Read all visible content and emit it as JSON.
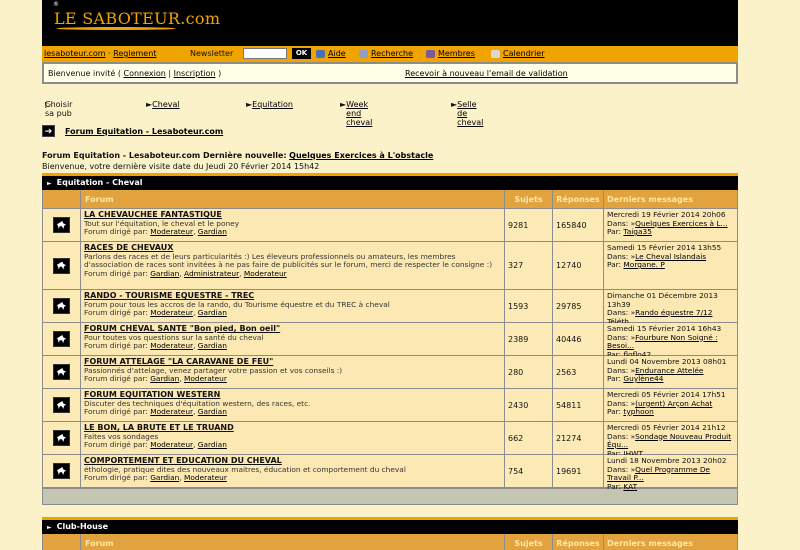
{
  "site": {
    "logo_text": "LE SABOTEUR.com",
    "logo_mark": "®"
  },
  "nav": {
    "home": "lesaboteur.com",
    "sep": " · ",
    "rules": "Reglement",
    "newsletter_label": "Newsletter",
    "newsletter_value": "",
    "ok_label": "OK",
    "items": [
      {
        "label": "Aide",
        "icon": "help-icon"
      },
      {
        "label": "Recherche",
        "icon": "search-icon"
      },
      {
        "label": "Membres",
        "icon": "members-icon"
      },
      {
        "label": "Calendrier",
        "icon": "calendar-icon"
      }
    ]
  },
  "welcome": {
    "prefix": "Bienvenue invité (",
    "login": "Connexion",
    "sep": "|",
    "signup": "Inscription",
    "suffix": ")",
    "email_link": "Recevoir à nouveau l'email de validation"
  },
  "promo": {
    "label": "Choisir sa pub",
    "links": [
      "Cheval",
      "Equitation",
      "Week end cheval",
      "Selle de cheval"
    ]
  },
  "breadcrumb": {
    "label": "Forum Equitation - Lesaboteur.com"
  },
  "info": {
    "title": "Forum Equitation - Lesaboteur.com Dernière nouvelle:",
    "news_link": "Quelques Exercices à L'obstacle",
    "last_visit": "Bienvenue, votre dernière visite date du Jeudi 20 Février 2014 15h42"
  },
  "columns": {
    "forum": "Forum",
    "topics": "Sujets",
    "replies": "Réponses",
    "last": "Derniers messages"
  },
  "categories": [
    {
      "name": "Equitation - Cheval",
      "forums": [
        {
          "title": "LA CHEVAUCHEE FANTASTIQUE",
          "desc": "Tout sur l'équitation, le cheval et le poney",
          "mod_prefix": "Forum dirigé par:",
          "mods": [
            "Moderateur",
            "Gardian"
          ],
          "topics": "9281",
          "replies": "165840",
          "last_date": "Mercredi 19 Février 2014 20h06",
          "last_in_prefix": "Dans: »",
          "last_in": "Quelques Exercices à L...",
          "last_by_prefix": "Par:",
          "last_by": "Taiga35"
        },
        {
          "title": "RACES DE CHEVAUX",
          "desc": "Parlons des races et de leurs particularités :) Les éleveurs professionnels ou amateurs, les membres d'association de races sont invitées à  ne pas faire de publicités sur le forum, merci de respecter le consigne :)",
          "mod_prefix": "Forum dirigé par:",
          "mods": [
            "Gardian",
            "Administrateur",
            "Moderateur"
          ],
          "topics": "327",
          "replies": "12740",
          "last_date": "Samedi 15 Février 2014 13h55",
          "last_in_prefix": "Dans: »",
          "last_in": "Le Cheval Islandais",
          "last_by_prefix": "Par:",
          "last_by": "Morgane. P"
        },
        {
          "title": "RANDO - TOURISME EQUESTRE - TREC",
          "desc": "Forum pour tous les accros de la rando, du Tourisme équestre et du TREC à cheval",
          "mod_prefix": "Forum dirigé par:",
          "mods": [
            "Moderateur",
            "Gardian"
          ],
          "topics": "1593",
          "replies": "29785",
          "last_date": "Dimanche 01 Décembre 2013 13h39",
          "last_in_prefix": "Dans: »",
          "last_in": "Rando équestre 7/12 Téléth...",
          "last_by_prefix": "Par:",
          "last_by": "oslo1980"
        },
        {
          "title": "FORUM CHEVAL SANTE \"Bon pied, Bon oeil\"",
          "desc": "Pour toutes vos questions sur la santé du cheval",
          "mod_prefix": "Forum dirigé par:",
          "mods": [
            "Moderateur",
            "Gardian"
          ],
          "topics": "2389",
          "replies": "40446",
          "last_date": "Samedi 15 Février 2014 16h43",
          "last_in_prefix": "Dans: »",
          "last_in": "Fourbure Non Soigné : Besoi...",
          "last_by_prefix": "Par:",
          "last_by": "floflo42"
        },
        {
          "title": "FORUM ATTELAGE \"LA CARAVANE DE FEU\"",
          "desc": "Passionnés d'attelage, venez partager votre passion et vos conseils :)",
          "mod_prefix": "Forum dirigé par:",
          "mods": [
            "Gardian",
            "Moderateur"
          ],
          "topics": "280",
          "replies": "2563",
          "last_date": "Lundi 04 Novembre 2013 08h01",
          "last_in_prefix": "Dans: »",
          "last_in": "Endurance Attelée",
          "last_by_prefix": "Par:",
          "last_by": "Guylène44"
        },
        {
          "title": "FORUM EQUITATION WESTERN",
          "desc": "Discuter des techniques d'équitation western, des races, etc.",
          "mod_prefix": "Forum dirigé par:",
          "mods": [
            "Moderateur",
            "Gardian"
          ],
          "topics": "2430",
          "replies": "54811",
          "last_date": "Mercredi 05 Février 2014 17h51",
          "last_in_prefix": "Dans: »",
          "last_in": "(urgent) Arçon Achat",
          "last_by_prefix": "Par:",
          "last_by": "typhoon"
        },
        {
          "title": "LE BON, LA BRUTE ET LE TRUAND",
          "desc": "Faites vos sondages",
          "mod_prefix": "Forum dirigé par:",
          "mods": [
            "Moderateur",
            "Gardian"
          ],
          "topics": "662",
          "replies": "21274",
          "last_date": "Mercredi 05 Février 2014 21h12",
          "last_in_prefix": "Dans: »",
          "last_in": "Sondage Nouveau Produit Équ...",
          "last_by_prefix": "Par:",
          "last_by": "IHWT"
        },
        {
          "title": "COMPORTEMENT ET EDUCATION DU CHEVAL",
          "desc": "éthologie, pratique dites des nouveaux maitres, éducation et comportement du cheval",
          "mod_prefix": "Forum dirigé par:",
          "mods": [
            "Gardian",
            "Moderateur"
          ],
          "topics": "754",
          "replies": "19691",
          "last_date": "Lundi 18 Novembre 2013 20h02",
          "last_in_prefix": "Dans: »",
          "last_in": "Quel Programme De Travail P...",
          "last_by_prefix": "Par:",
          "last_by": "KAT"
        }
      ]
    },
    {
      "name": "Club-House",
      "forums": []
    }
  ],
  "colors": {
    "accent": "#f0a400",
    "background": "#fcf2c9",
    "header": "#000000",
    "colhead": "#e2a33f"
  }
}
